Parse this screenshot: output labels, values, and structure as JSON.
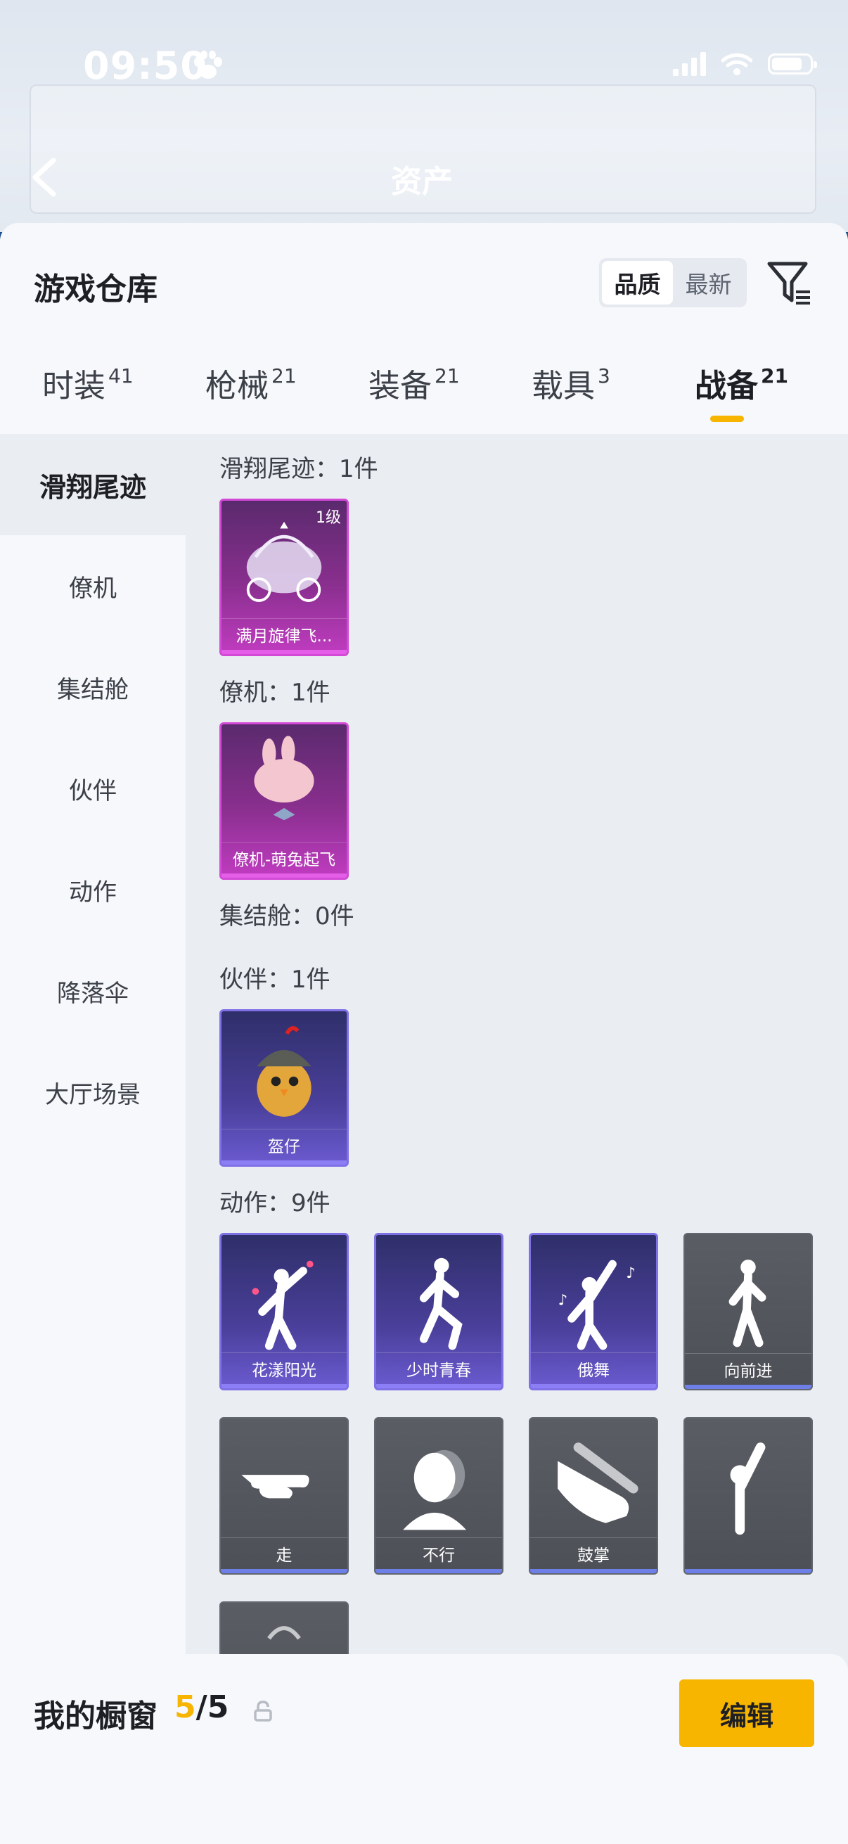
{
  "status_bar": {
    "time": "09:50"
  },
  "header": {
    "title": "资产"
  },
  "warehouse": {
    "title": "游戏仓库",
    "sort_options": [
      "品质",
      "最新"
    ],
    "tabs": [
      {
        "label": "时装",
        "count": "41"
      },
      {
        "label": "枪械",
        "count": "21"
      },
      {
        "label": "装备",
        "count": "21"
      },
      {
        "label": "载具",
        "count": "3"
      },
      {
        "label": "战备",
        "count": "21"
      }
    ],
    "active_tab": "战备"
  },
  "sidebar": {
    "items": [
      "滑翔尾迹",
      "僚机",
      "集结舱",
      "伙伴",
      "动作",
      "降落伞",
      "大厅场景"
    ],
    "active": "滑翔尾迹"
  },
  "sections": [
    {
      "label": "滑翔尾迹：1件",
      "items": [
        {
          "name": "满月旋律飞...",
          "level": "1级",
          "rarity": "purple"
        }
      ]
    },
    {
      "label": "僚机：1件",
      "items": [
        {
          "name": "僚机-萌兔起飞",
          "rarity": "purple"
        }
      ]
    },
    {
      "label": "集结舱：0件",
      "items": []
    },
    {
      "label": "伙伴：1件",
      "items": [
        {
          "name": "盔仔",
          "rarity": "violet"
        }
      ]
    },
    {
      "label": "动作：9件",
      "items": [
        {
          "name": "花漾阳光",
          "rarity": "violet"
        },
        {
          "name": "少时青春",
          "rarity": "violet"
        },
        {
          "name": "俄舞",
          "rarity": "violet"
        },
        {
          "name": "向前进",
          "rarity": "gray"
        },
        {
          "name": "走",
          "rarity": "gray"
        },
        {
          "name": "不行",
          "rarity": "gray"
        },
        {
          "name": "鼓掌",
          "rarity": "gray"
        }
      ]
    }
  ],
  "showcase": {
    "label": "我的橱窗",
    "current": "5",
    "total": "/5",
    "edit_label": "编辑"
  },
  "colors": {
    "accent": "#f7b500",
    "purple_border": "#d24ad6",
    "violet_border": "#7f70e6"
  }
}
